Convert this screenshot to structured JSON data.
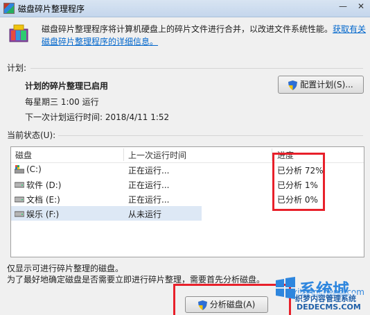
{
  "window": {
    "title": "磁盘碎片整理程序",
    "minimize_glyph": "—",
    "close_glyph": "✕"
  },
  "header": {
    "description": "磁盘碎片整理程序将计算机硬盘上的碎片文件进行合并，以改进文件系统性能。",
    "link_text": "获取有关磁盘碎片整理程序的详细信息。"
  },
  "schedule": {
    "section_label": "计划:",
    "status_title": "计划的碎片整理已启用",
    "run_time": "每星期三  1:00 运行",
    "next_run": "下一次计划运行时间: 2018/4/11 1:52",
    "configure_button": "配置计划(S)..."
  },
  "current_status": {
    "label": "当前状态(U):",
    "columns": [
      "磁盘",
      "上一次运行时间",
      "进度"
    ],
    "rows": [
      {
        "disk": "(C:)",
        "last_run": "正在运行...",
        "progress": "已分析 72%",
        "icon": "system-drive-icon"
      },
      {
        "disk": "软件 (D:)",
        "last_run": "正在运行...",
        "progress": "已分析 1%",
        "icon": "drive-icon"
      },
      {
        "disk": "文档 (E:)",
        "last_run": "正在运行...",
        "progress": "已分析 0%",
        "icon": "drive-icon"
      },
      {
        "disk": "娱乐 (F:)",
        "last_run": "从未运行",
        "progress": "",
        "icon": "drive-icon"
      }
    ]
  },
  "notes": {
    "line1": "仅显示可进行碎片整理的磁盘。",
    "line2": "为了最好地确定磁盘是否需要立即进行碎片整理，需要首先分析磁盘。"
  },
  "analyze_button": "分析磁盘(A)",
  "watermark": {
    "brand": "系统城",
    "domain": "xitongcheng.com",
    "site_name": "织梦内容管理系统",
    "site_domain": "DEDECMS.COM"
  },
  "colors": {
    "highlight": "#e8202a",
    "link": "#0066cc",
    "selected_row": "#dde8f5"
  }
}
